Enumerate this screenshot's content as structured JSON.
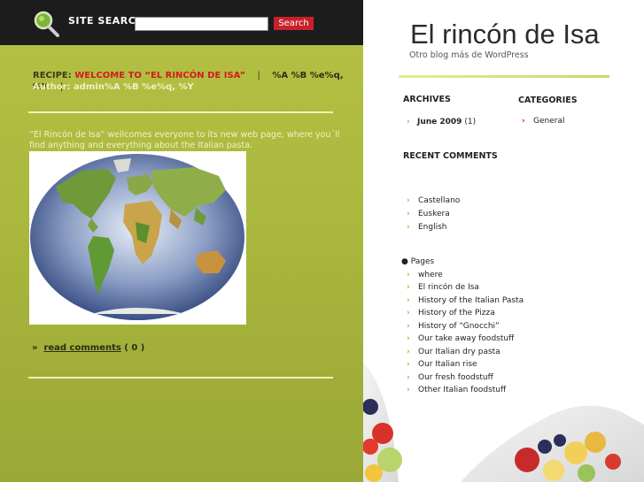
{
  "search": {
    "label": "SITE SEARCH:",
    "placeholder": "",
    "value": "",
    "button": "Search"
  },
  "post": {
    "recipe_prefix": "RECIPE:",
    "title": "WELCOME TO “EL RINCÓN DE ISA”",
    "meta1": "%A %B %e%q, %Y",
    "author": "Author: admin%A %B %e%q, %Y",
    "body": "“El Rincón de Isa” wellcomes everyone to its new web page, where you´ll find anything and everything about the Italian pasta.",
    "comments_prefix": "»",
    "comments_link": "read comments",
    "comments_count": "( 0 )"
  },
  "site": {
    "title": "El rincón de Isa",
    "tagline": "Otro blog más de WordPress"
  },
  "sidebar": {
    "archives_title": "ARCHIVES",
    "archives": [
      {
        "label": "June 2009",
        "count": "(1)"
      }
    ],
    "categories_title": "CATEGORIES",
    "categories": [
      "General"
    ],
    "recent_comments_title": "RECENT COMMENTS",
    "languages": [
      "Castellano",
      "Euskera",
      "English"
    ],
    "pages_title": "Pages",
    "pages": [
      "where",
      "El rincón de Isa",
      "History of the Italian Pasta",
      "History of the Pizza",
      "History of “Gnocchi”",
      "Our take away foodstuff",
      "Our Italian dry pasta",
      "Our Italian rise",
      "Our fresh foodstuff",
      "Other Italian foodstuff"
    ]
  },
  "colors": {
    "accent_red": "#d6191f",
    "left_green": "#aab83e",
    "top_bar": "#1c1c1c"
  },
  "icons": [
    "magnifier-icon",
    "chevron-right-icon",
    "bullet-icon"
  ]
}
